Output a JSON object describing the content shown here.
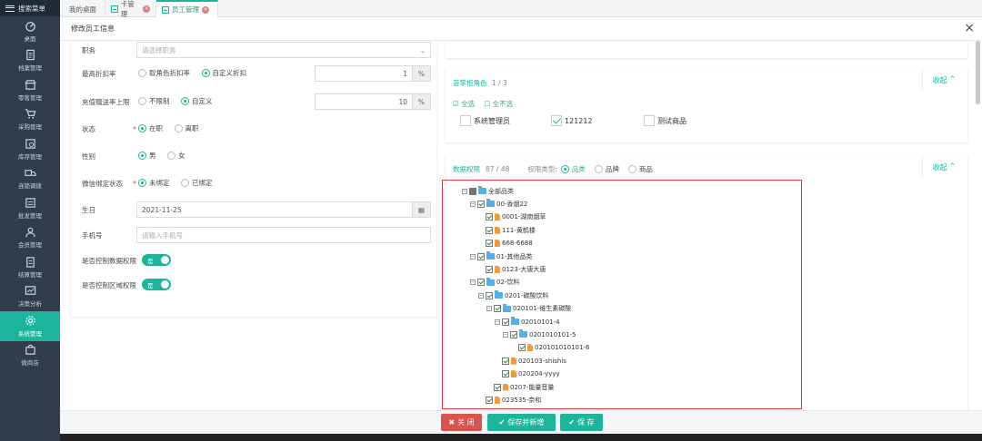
{
  "sidebar": {
    "menu_label": "搜索菜单",
    "items": [
      {
        "label": "桌面",
        "icon": "dashboard-icon"
      },
      {
        "label": "档案管理",
        "icon": "document-icon"
      },
      {
        "label": "零售管理",
        "icon": "store-icon"
      },
      {
        "label": "采购管理",
        "icon": "cart-icon"
      },
      {
        "label": "库存管理",
        "icon": "inventory-icon"
      },
      {
        "label": "连锁调拨",
        "icon": "truck-icon"
      },
      {
        "label": "批发管理",
        "icon": "wholesale-icon"
      },
      {
        "label": "会员管理",
        "icon": "member-icon"
      },
      {
        "label": "结算管理",
        "icon": "settlement-icon"
      },
      {
        "label": "决策分析",
        "icon": "analysis-icon"
      },
      {
        "label": "系统管理",
        "icon": "gear-icon",
        "active": true
      },
      {
        "label": "微商店",
        "icon": "shop-icon"
      }
    ]
  },
  "tabs": [
    {
      "label": "我的桌面"
    },
    {
      "label": "卡管理"
    },
    {
      "label": "员工管理",
      "active": true
    }
  ],
  "modal": {
    "title": "修改员工信息",
    "close": "×"
  },
  "form": {
    "position_label": "职务",
    "position_placeholder": "请选择职务",
    "discount_label": "最高折扣率",
    "discount_opt1": "取角色折扣率",
    "discount_opt2": "自定义折扣",
    "discount_value": "1",
    "discount_unit": "%",
    "recharge_label": "充值赠送率上限",
    "recharge_opt1": "不限制",
    "recharge_opt2": "自定义",
    "recharge_value": "10",
    "recharge_unit": "%",
    "status_label": "状态",
    "status_opt1": "在职",
    "status_opt2": "离职",
    "gender_label": "性别",
    "gender_opt1": "男",
    "gender_opt2": "女",
    "wechat_label": "微信绑定状态",
    "wechat_opt1": "未绑定",
    "wechat_opt2": "已绑定",
    "birthday_label": "生日",
    "birthday_value": "2021-11-25",
    "phone_label": "手机号",
    "phone_placeholder": "请输入手机号",
    "data_perm_label": "是否控制数据权限",
    "data_perm_value": "是",
    "area_perm_label": "是否控制区域权限",
    "area_perm_value": "是"
  },
  "roles": {
    "title": "荟掌柜角色",
    "count": "1 / 3",
    "collapse": "收起",
    "select_all": "全选",
    "select_none": "全不选",
    "items": [
      {
        "label": "系统管理员",
        "checked": false
      },
      {
        "label": "121212",
        "checked": true
      },
      {
        "label": "测试商品",
        "checked": false
      }
    ]
  },
  "data_perm": {
    "title": "数据权限",
    "count": "87 / 48",
    "type_label": "权限类型:",
    "type_opt1": "品类",
    "type_opt2": "品牌",
    "type_opt3": "商品",
    "collapse": "收起"
  },
  "tree": [
    {
      "label": "全部品类",
      "level": 0,
      "kind": "folder",
      "state": "part",
      "toggle": "−"
    },
    {
      "label": "00-香烟22",
      "level": 1,
      "kind": "folder",
      "state": "on",
      "toggle": "−"
    },
    {
      "label": "0001-湖南烟草",
      "level": 2,
      "kind": "file",
      "state": "on"
    },
    {
      "label": "111-黄鹤楼",
      "level": 2,
      "kind": "file",
      "state": "on"
    },
    {
      "label": "668-6688",
      "level": 2,
      "kind": "file",
      "state": "on"
    },
    {
      "label": "01-其他品类",
      "level": 1,
      "kind": "folder",
      "state": "on",
      "toggle": "−"
    },
    {
      "label": "0123-大唐大唐",
      "level": 2,
      "kind": "file",
      "state": "on"
    },
    {
      "label": "02-饮料",
      "level": 1,
      "kind": "folder",
      "state": "on",
      "toggle": "−"
    },
    {
      "label": "0201-碳酸饮料",
      "level": 2,
      "kind": "folder",
      "state": "on",
      "toggle": "−"
    },
    {
      "label": "020101-维生素碳酸",
      "level": 3,
      "kind": "folder",
      "state": "on",
      "toggle": "−"
    },
    {
      "label": "02010101-4",
      "level": 4,
      "kind": "folder",
      "state": "on",
      "toggle": "−"
    },
    {
      "label": "0201010101-5",
      "level": 5,
      "kind": "folder",
      "state": "on",
      "toggle": "−"
    },
    {
      "label": "020101010101-6",
      "level": 6,
      "kind": "file",
      "state": "on"
    },
    {
      "label": "020103-shishis",
      "level": 4,
      "kind": "file",
      "state": "on"
    },
    {
      "label": "020204-yyyy",
      "level": 4,
      "kind": "file",
      "state": "on"
    },
    {
      "label": "0207-能量音量",
      "level": 3,
      "kind": "file",
      "state": "on"
    },
    {
      "label": "023535-奈和",
      "level": 2,
      "kind": "file",
      "state": "on"
    }
  ],
  "buttons": {
    "close": "关 闭",
    "save_new": "保存并新增",
    "save": "保 存"
  }
}
